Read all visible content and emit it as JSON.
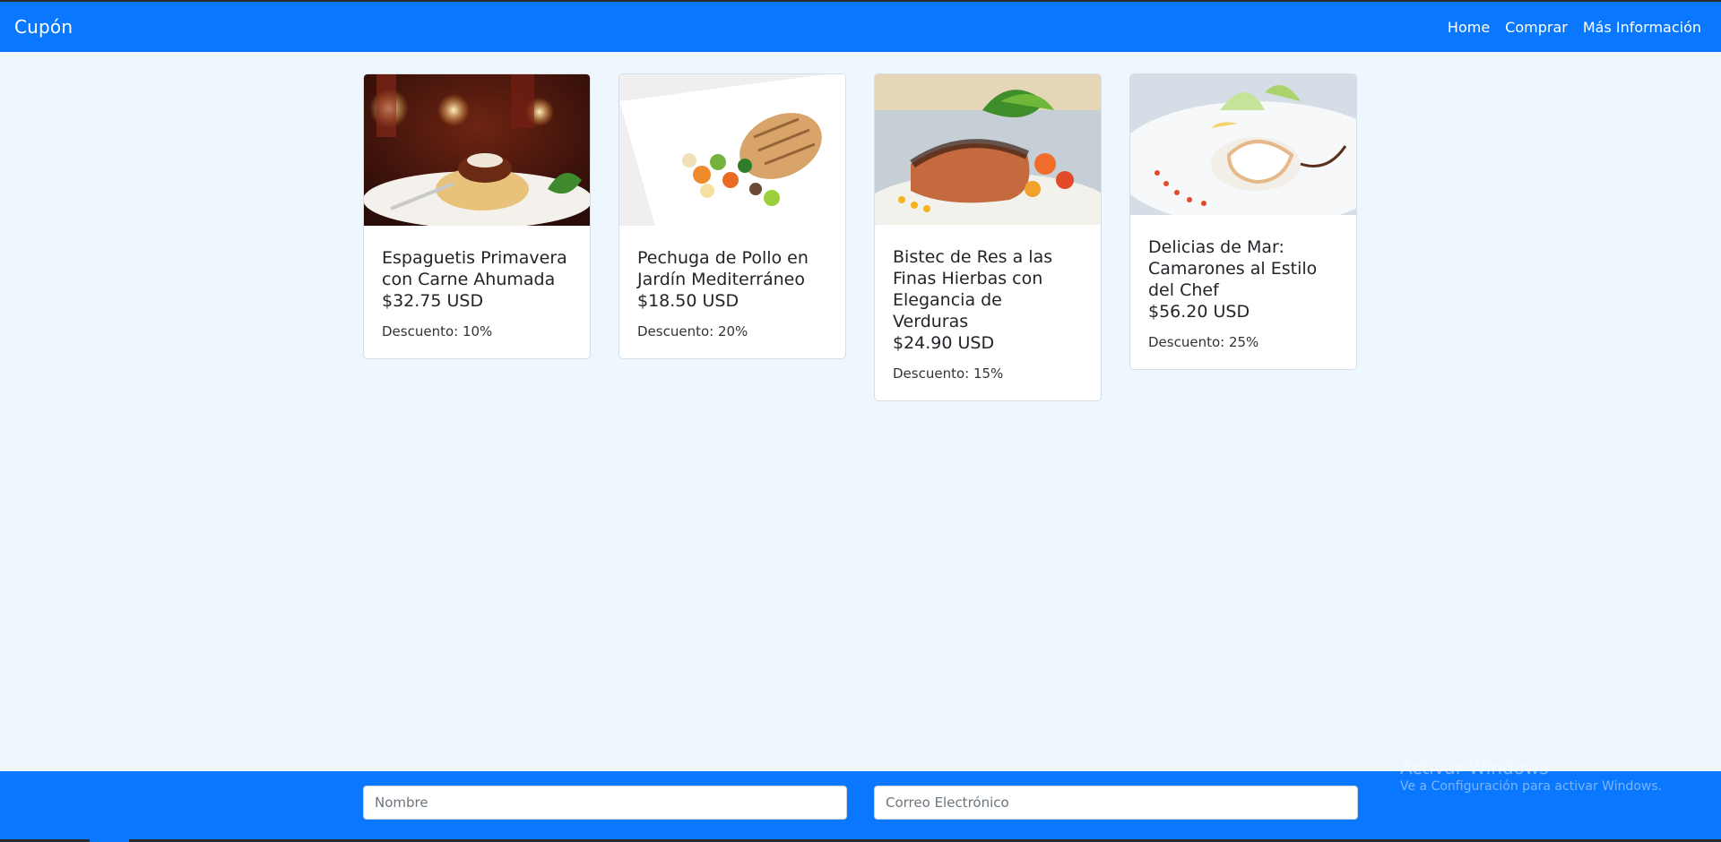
{
  "navbar": {
    "brand": "Cupón",
    "links": [
      "Home",
      "Comprar",
      "Más Información"
    ]
  },
  "cards": [
    {
      "title": "Espaguetis Primavera con Carne Ahumada",
      "price": "$32.75 USD",
      "discount": "Descuento: 10%"
    },
    {
      "title": "Pechuga de Pollo en Jardín Mediterráneo",
      "price": "$18.50 USD",
      "discount": "Descuento: 20%"
    },
    {
      "title": "Bistec de Res a las Finas Hierbas con Elegancia de Verduras",
      "price": "$24.90 USD",
      "discount": "Descuento: 15%"
    },
    {
      "title": "Delicias de Mar: Camarones al Estilo del Chef",
      "price": "$56.20 USD",
      "discount": "Descuento: 25%"
    }
  ],
  "form": {
    "name_placeholder": "Nombre",
    "email_placeholder": "Correo Electrónico"
  },
  "watermark": {
    "title": "Activar Windows",
    "subtitle": "Ve a Configuración para activar Windows."
  },
  "colors": {
    "primary": "#0a78fe",
    "background": "#eef6fe"
  }
}
